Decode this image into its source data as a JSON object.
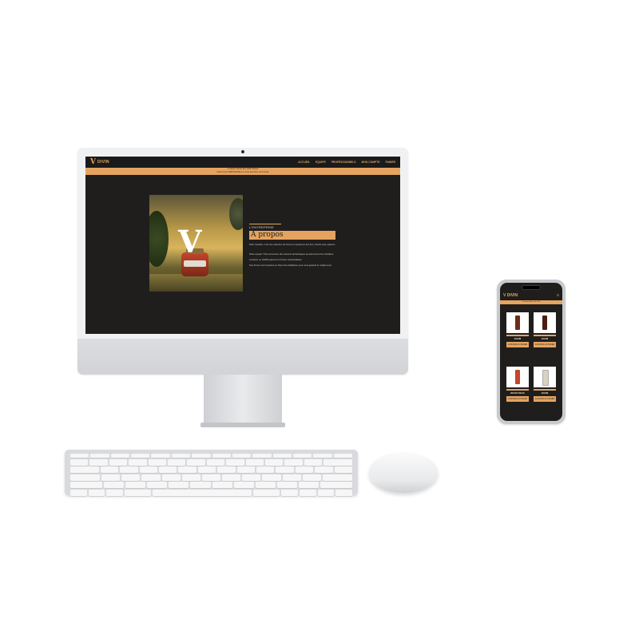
{
  "website": {
    "logo_mark": "V",
    "logo_word": "DIVIN",
    "nav": [
      "ACCUEIL",
      "EQUIPE",
      "PROFESSIONNELS",
      "MON COMPTE",
      "PANIER"
    ],
    "banner_line1": "Livraison offerte dès 100€ d'achat",
    "banner_line2": "Code promo BIENVENUE sur votre première commande",
    "kicker": "L'ENTREPRISE",
    "about_title": "A propos",
    "paragraphs": [
      "Divin Caraïbe, c'est une sélection de rhums et spiritueux des îles, choisis avec passion.",
      "Notre équipe ? Des amoureux des saveurs authentiques qui parcourent les Caraïbes.",
      "Livraison en 24/48h partout en France métropolitaine.",
      "Nos rhums sont importés en direct des distilleries pour vous garantir le meilleur prix."
    ]
  },
  "phone_site": {
    "logo": "V DIVIN",
    "menu_icon": "menu-icon",
    "banner": "Livraison offerte dès 100€",
    "products": [
      {
        "name": "RHUM",
        "price": "",
        "button": "AJOUTER AU PANIER",
        "bottle_color": "#6b2d1a"
      },
      {
        "name": "RHUM",
        "price": "",
        "button": "AJOUTER AU PANIER",
        "bottle_color": "#4a1f12"
      },
      {
        "name": "RHUM VIEUX",
        "price": "",
        "button": "AJOUTER AU PANIER",
        "bottle_color": "#c4462c"
      },
      {
        "name": "RHUM",
        "price": "",
        "button": "AJOUTER AU PANIER",
        "bottle_color": "#d9d2c2"
      }
    ]
  },
  "colors": {
    "accent": "#e4a45f",
    "site_bg": "#1f1e1d",
    "device_silver": "#e3e4e6"
  }
}
